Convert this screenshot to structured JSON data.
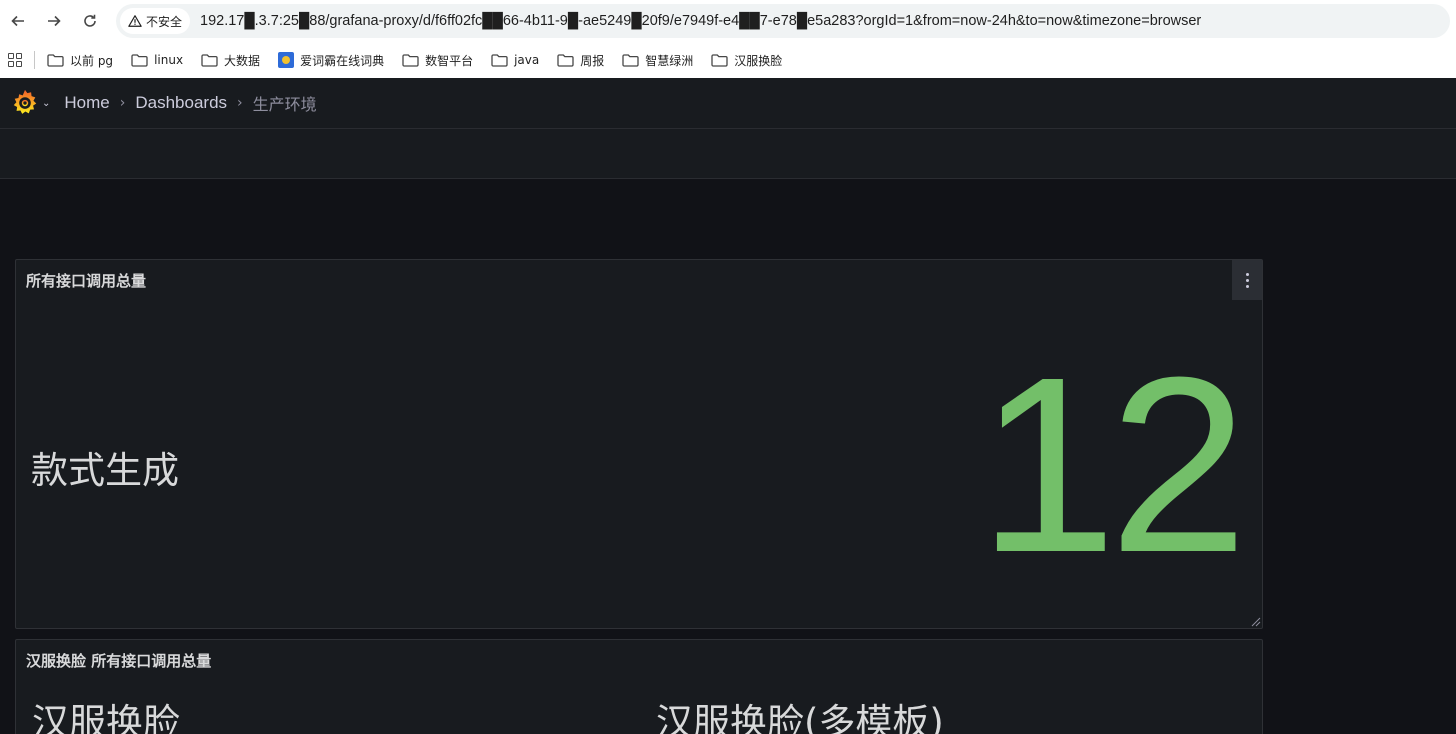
{
  "browser": {
    "security_label": "不安全",
    "url": "192.17█.3.7:25█88/grafana-proxy/d/f6ff02fc██66-4b11-9█-ae5249█20f9/e7949f-e4██7-e78█e5a283?orgId=1&from=now-24h&to=now&timezone=browser",
    "bookmarks": [
      {
        "label": "以前 pg",
        "icon": "folder-icon"
      },
      {
        "label": "linux",
        "icon": "folder-icon"
      },
      {
        "label": "大数据",
        "icon": "folder-icon"
      },
      {
        "label": "爱词霸在线词典",
        "icon": "dict-icon"
      },
      {
        "label": "数智平台",
        "icon": "folder-icon"
      },
      {
        "label": "java",
        "icon": "folder-icon"
      },
      {
        "label": "周报",
        "icon": "folder-icon"
      },
      {
        "label": "智慧绿洲",
        "icon": "folder-icon"
      },
      {
        "label": "汉服换脸",
        "icon": "folder-icon"
      }
    ]
  },
  "grafana": {
    "breadcrumb": {
      "home": "Home",
      "dashboards": "Dashboards",
      "current": "生产环境"
    },
    "panels": [
      {
        "title": "所有接口调用总量",
        "stats": [
          {
            "name": "款式生成",
            "value": "12"
          }
        ]
      },
      {
        "title": "汉服换脸 所有接口调用总量",
        "stats": [
          {
            "name": "汉服换脸"
          },
          {
            "name": "汉服换脸(多模板)"
          }
        ]
      }
    ],
    "colors": {
      "stat_value": "#73bf69",
      "background": "#111217",
      "panel_bg": "#181b1f"
    }
  }
}
